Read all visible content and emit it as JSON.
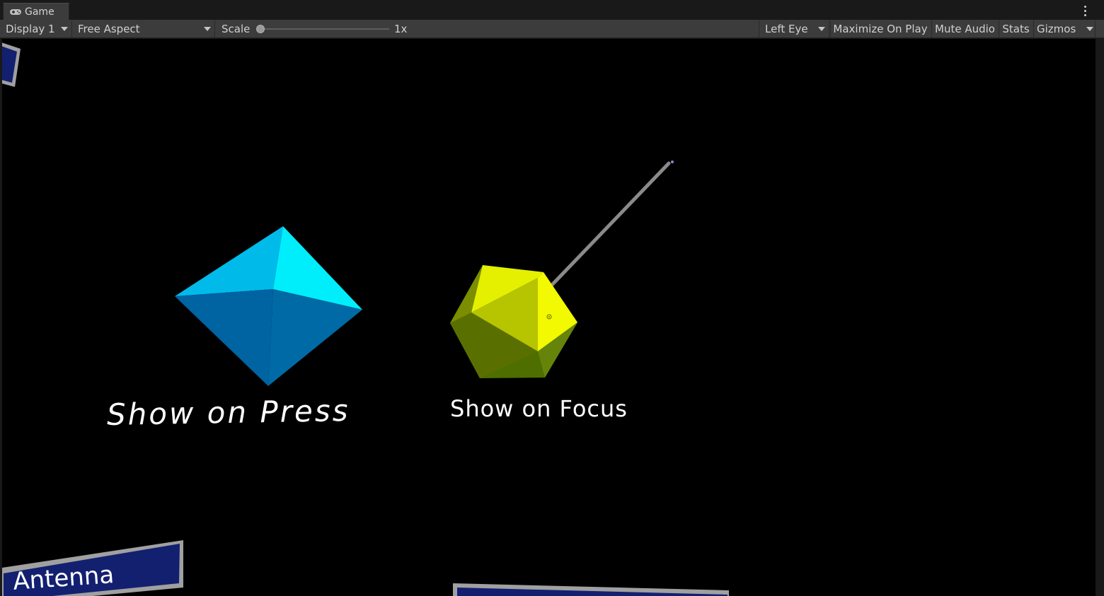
{
  "tab": {
    "title": "Game",
    "icon": "gamepad-icon"
  },
  "toolbar": {
    "display": "Display 1",
    "aspect": "Free Aspect",
    "scale_label": "Scale",
    "scale_value": "1x",
    "eye": "Left Eye",
    "maximize_on_play": "Maximize On Play",
    "mute_audio": "Mute Audio",
    "stats": "Stats",
    "gizmos": "Gizmos"
  },
  "scene": {
    "label_press": "Show on Press",
    "label_focus": "Show on Focus",
    "card_text": "Antenna",
    "colors": {
      "octahedron_light": "#00c8f0",
      "octahedron_dark": "#0068a8",
      "icosahedron_light": "#e8f000",
      "icosahedron_dark": "#4e6e00",
      "ray": "#8a8a8a",
      "card": "#132070",
      "card_border": "#a0a0a0"
    }
  }
}
